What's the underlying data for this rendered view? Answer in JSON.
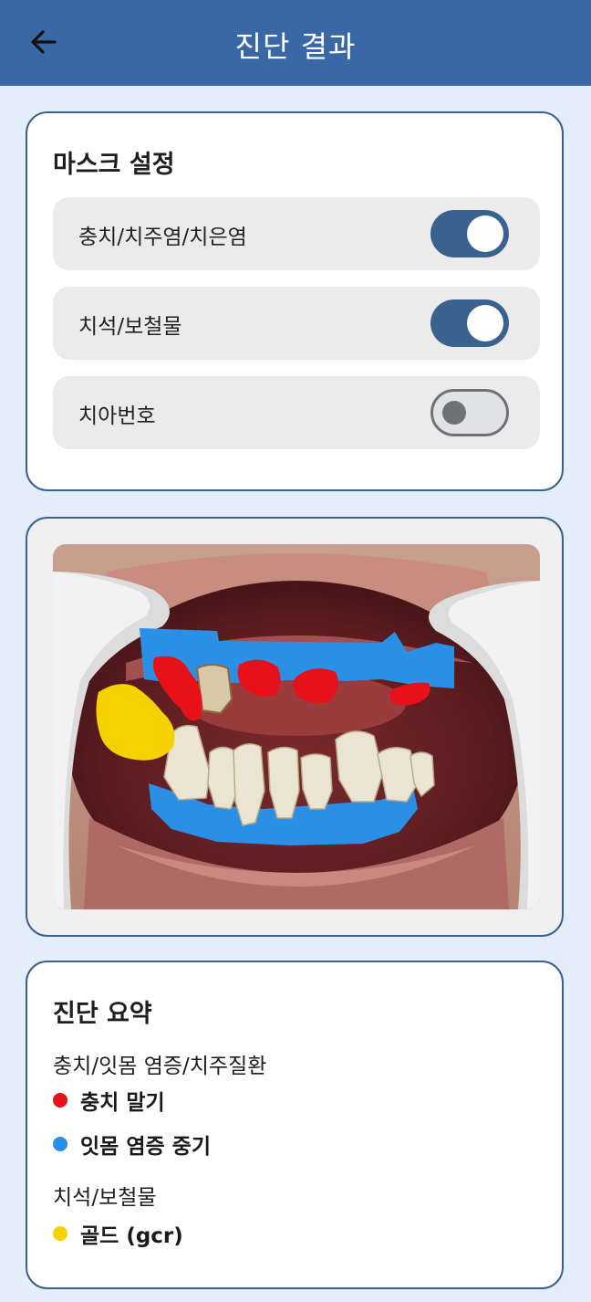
{
  "header": {
    "title": "진단 결과",
    "back_icon": "arrow-left-icon"
  },
  "mask_settings": {
    "title": "마스크 설정",
    "toggles": [
      {
        "label": "충치/치주염/치은염",
        "on": true
      },
      {
        "label": "치석/보철물",
        "on": true
      },
      {
        "label": "치아번호",
        "on": false
      }
    ]
  },
  "summary": {
    "title": "진단 요약",
    "groups": [
      {
        "title": "충치/잇몸 염증/치주질환",
        "items": [
          {
            "label": "충치 말기",
            "color": "#e8111a"
          },
          {
            "label": "잇몸 염증 중기",
            "color": "#2b8fe6"
          }
        ]
      },
      {
        "title": "치석/보철물",
        "items": [
          {
            "label": "골드 (gcr)",
            "color": "#f6d100"
          }
        ]
      }
    ]
  },
  "colors": {
    "app_bar": "#3a68a7",
    "background": "#e4eefb",
    "switch_on": "#3a628f",
    "card_border": "#3a5f94"
  }
}
